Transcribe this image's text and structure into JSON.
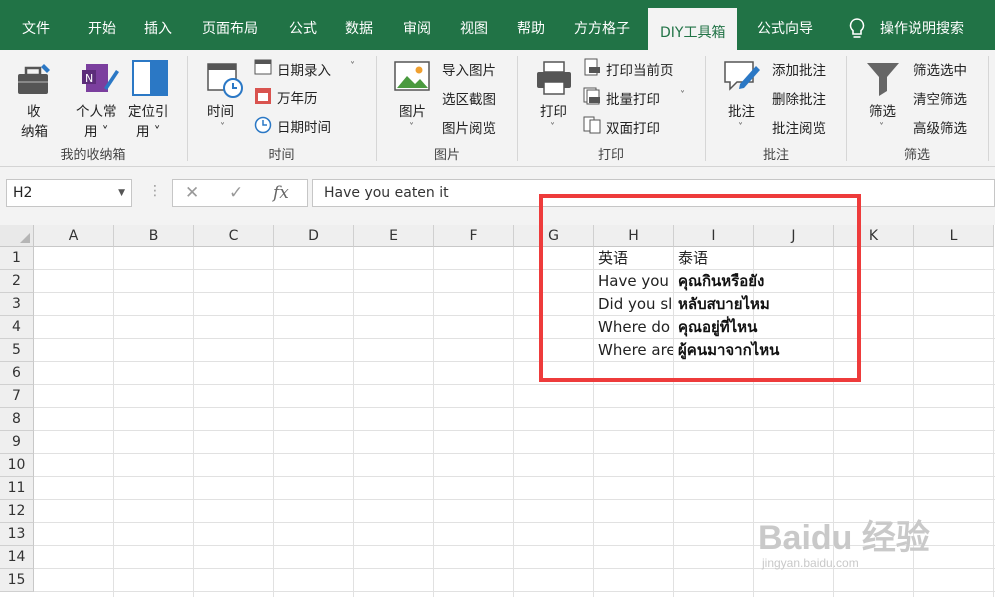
{
  "menu": {
    "tabs": [
      "文件",
      "开始",
      "插入",
      "页面布局",
      "公式",
      "数据",
      "审阅",
      "视图",
      "帮助",
      "方方格子",
      "DIY工具箱",
      "公式向导"
    ],
    "active_tab": "DIY工具箱",
    "search_label": "操作说明搜索"
  },
  "ribbon": {
    "g1": {
      "label": "我的收纳箱",
      "btn1": "收",
      "btn1b": "纳箱",
      "btn2": "个人常",
      "btn2b": "用 ˅",
      "btn3": "定位引",
      "btn3b": "用 ˅"
    },
    "g2": {
      "label": "时间",
      "time_btn": "时间",
      "date_entry": "日期录入",
      "calendar": "万年历",
      "datetime": "日期时间"
    },
    "g3": {
      "label": "图片",
      "pic_btn": "图片",
      "import_pic": "导入图片",
      "select_shot": "选区截图",
      "pic_view": "图片阅览"
    },
    "g4": {
      "label": "打印",
      "print_btn": "打印",
      "print_current": "打印当前页",
      "batch_print": "批量打印",
      "duplex_print": "双面打印"
    },
    "g5": {
      "label": "批注",
      "comment_btn": "批注",
      "add_comment": "添加批注",
      "delete_comment": "删除批注",
      "view_comment": "批注阅览"
    },
    "g6": {
      "label": "筛选",
      "filter_btn": "筛选",
      "filter_selected": "筛选选中",
      "clear_filter": "清空筛选",
      "adv_filter": "高级筛选"
    }
  },
  "formula_bar": {
    "name_box": "H2",
    "fx": "fx",
    "formula": "Have you eaten it"
  },
  "sheet": {
    "columns": [
      "A",
      "B",
      "C",
      "D",
      "E",
      "F",
      "G",
      "H",
      "I",
      "J",
      "K",
      "L"
    ],
    "rows": [
      "1",
      "2",
      "3",
      "4",
      "5",
      "6",
      "7",
      "8",
      "9",
      "10",
      "11",
      "12",
      "13",
      "14",
      "15"
    ],
    "cells": {
      "H1": "英语",
      "I1": "泰语",
      "H2": "Have you eaten it",
      "I2": "คุณกินหรือยัง",
      "H3": "Did you sleep well",
      "I3": "หลับสบายไหม",
      "H4": "Where do you live",
      "I4": "คุณอยู่ที่ไหน",
      "H5": "Where are you from",
      "I5": "ผู้คนมาจากไหน"
    }
  },
  "watermark": {
    "brand": "Baidu 经验",
    "url": "jingyan.baidu.com"
  },
  "colors": {
    "excel_green": "#217346",
    "highlight_red": "#ee3b3b"
  }
}
